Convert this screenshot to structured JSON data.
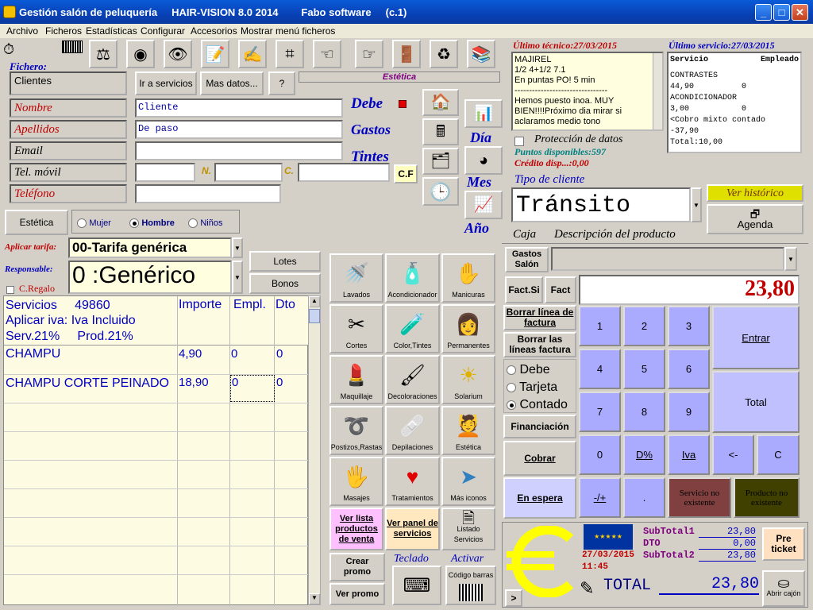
{
  "window": {
    "title": "Gestión salón de peluquería     HAIR-VISION 8.0 2014        Fabo software     (c.1)"
  },
  "menu": [
    "Archivo",
    "Ficheros",
    "Estadísticas",
    "Configurar",
    "Accesorios",
    "Mostrar menú ficheros"
  ],
  "toolbar_icons": [
    "barcode-icon",
    "scale-icon",
    "webcam-icon",
    "eye-icon",
    "notes-icon",
    "write-icon",
    "binoculars-icon",
    "hand-left-icon",
    "hand-right-icon",
    "door-icon",
    "trash-icon",
    "books-icon"
  ],
  "ficha": {
    "fichero_label": "Fichero:",
    "fichero_value": "Clientes",
    "ir_servicios": "Ir a servicios",
    "mas_datos": "Mas datos...",
    "help": "?",
    "estetica_tag": "Estética",
    "nombre_label": "Nombre",
    "nombre_value": "Cliente",
    "apellidos_label": "Apellidos",
    "apellidos_value": "De paso",
    "email_label": "Email",
    "email_value": "",
    "movil_label": "Tel. móvil",
    "n_label": "N.",
    "c_label": "C.",
    "cf_btn": "C.F",
    "telefono_label": "Teléfono",
    "debe": "Debe",
    "gastos": "Gastos",
    "tintes": "Tintes",
    "dia": "Día",
    "mes": "Mes",
    "anio": "Año"
  },
  "tecnico": {
    "header": "Último técnico:27/03/2015",
    "lines": [
      "MAJIREL",
      "1/2 4+1/2 7.1",
      "En puntas PO! 5 min",
      "--------------------------------",
      "Hemos puesto inoa. MUY BIEN!!!!Próximo dia mirar si aclaramos medio tono"
    ]
  },
  "servicio": {
    "header": "Último servicio:27/03/2015",
    "col1": "Servicio",
    "col2": "Empleado",
    "lines": [
      "CONTRASTES",
      "44,90          0",
      "ACONDICIONADOR",
      "3,00           0",
      "<Cobro mixto contado",
      "-37,90",
      "Total:10,00"
    ]
  },
  "proteccion": "Protección de datos",
  "puntos": "Puntos disponibles:597",
  "credito": "Crédito disp...:0,00",
  "tipo_cliente_label": "Tipo de cliente",
  "tipo_cliente_value": "Tránsito",
  "ver_historico": "Ver histórico",
  "agenda": "Agenda",
  "estetica_tab": "Estética",
  "genders": [
    "Mujer",
    "Hombre",
    "Niños"
  ],
  "aplicar_tarifa_label": "Aplicar tarifa:",
  "tarifa_value": "00-Tarifa genérica",
  "responsable_label": "Responsable:",
  "responsable_value": "0 :Genérico",
  "cregalo": "C.Regalo",
  "lotes": "Lotes",
  "bonos": "Bonos",
  "grid": {
    "h1": "Servicios     49860",
    "h2": "Aplicar iva: Iva Incluido",
    "h3": "Serv.21%     Prod.21%",
    "col_importe": "Importe",
    "col_empl": "Empl.",
    "col_dto": "Dto",
    "rows": [
      {
        "name": "CHAMPU",
        "importe": "4,90",
        "empl": "0",
        "dto": "0"
      },
      {
        "name": "CHAMPU CORTE PEINADO",
        "importe": "18,90",
        "empl": "0",
        "dto": "0"
      }
    ]
  },
  "categories": [
    {
      "label": "Lavados",
      "icon": "shower-icon",
      "glyph": "🚿"
    },
    {
      "label": "Acondicionador",
      "icon": "spray-icon",
      "glyph": "🧴"
    },
    {
      "label": "Manicuras",
      "icon": "hand-icon",
      "glyph": "✋"
    },
    {
      "label": "Cortes",
      "icon": "scissors-icon",
      "glyph": "✂"
    },
    {
      "label": "Color,Tintes",
      "icon": "dye-bottles-icon",
      "glyph": "🧪"
    },
    {
      "label": "Permanentes",
      "icon": "woman-curls-icon",
      "glyph": "👩"
    },
    {
      "label": "Maquillaje",
      "icon": "makeup-icon",
      "glyph": "💄"
    },
    {
      "label": "Decoloraciones",
      "icon": "brush-icon",
      "glyph": "🖌"
    },
    {
      "label": "Solarium",
      "icon": "sun-icon",
      "glyph": "☀"
    },
    {
      "label": "Postizos,Rastas",
      "icon": "hairpiece-icon",
      "glyph": "➰"
    },
    {
      "label": "Depilaciones",
      "icon": "wax-icon",
      "glyph": "🩹"
    },
    {
      "label": "Estética",
      "icon": "face-icon",
      "glyph": "💆"
    },
    {
      "label": "Masajes",
      "icon": "massage-hand-icon",
      "glyph": "🖐"
    },
    {
      "label": "Tratamientos",
      "icon": "heart-icon",
      "glyph": "♥"
    },
    {
      "label": "Más iconos",
      "icon": "arrow-icon",
      "glyph": "➤"
    }
  ],
  "ver_lista": "Ver lista productos de venta",
  "ver_panel": "Ver panel de servicios",
  "listado": "Listado Servicios",
  "crear_promo": "Crear promo",
  "ver_promo": "Ver promo",
  "teclado": "Teclado",
  "activar": "Activar",
  "codigo_barras": "Código barras",
  "caja": "Caja",
  "descripcion": "Descripción del producto",
  "gastos_salon": "Gastos Salón",
  "fact_si": "Fact.Si",
  "fact": "Fact",
  "amount": "23,80",
  "borrar_linea": "Borrar línea de factura",
  "borrar_lineas": "Borrar las líneas factura",
  "pay": [
    "Debe",
    "Tarjeta",
    "Contado"
  ],
  "financiacion": "Financiación",
  "cobrar": "Cobrar",
  "en_espera": "En espera",
  "keys": [
    "1",
    "2",
    "3",
    "4",
    "5",
    "6",
    "7",
    "8",
    "9",
    "0",
    "D%",
    "Iva",
    "<-",
    "C",
    "-/+",
    "."
  ],
  "entrar": "Entrar",
  "total_btn": "Total",
  "servicio_no": "Servicio no existente",
  "producto_no": "Producto no existente",
  "totals": {
    "sub1_label": "SubTotal1",
    "sub1": "23,80",
    "dto_label": "DTO",
    "dto": "0,00",
    "sub2_label": "SubTotal2",
    "sub2": "23,80",
    "date": "27/03/2015",
    "time": "11:45",
    "total_label": "TOTAL",
    "total": "23,80"
  },
  "pre_ticket": "Pre ticket",
  "abrir_cajon": "Abrir cajón",
  "more": ">",
  "colors": {
    "title_blue": "#0841b6",
    "keypad": "#aaaaff",
    "grid_bg": "#fdfbe2",
    "red_label": "#c00000",
    "euro": "#ffff00"
  }
}
